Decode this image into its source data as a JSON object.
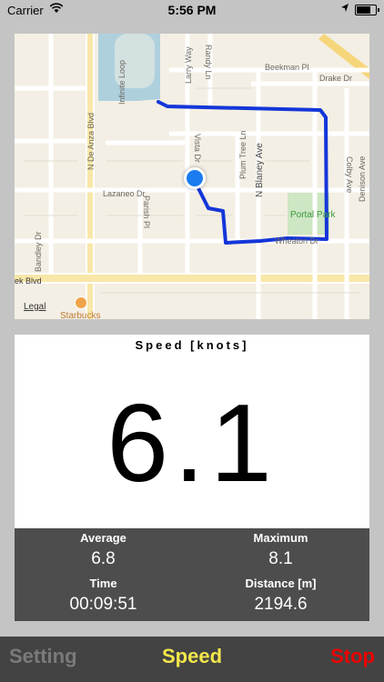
{
  "status_bar": {
    "carrier": "Carrier",
    "time": "5:56 PM",
    "battery_level": 0.85
  },
  "map": {
    "streets": [
      "Beekman Pl",
      "Drake Dr",
      "Larry Way",
      "Randy Ln",
      "Infinite Loop",
      "N De Anza Blvd",
      "Vista Dr",
      "Plum Tree Ln",
      "N Blaney Ave",
      "Colby Ave",
      "Denison Ave",
      "Lazaneo Dr",
      "Parish Pl",
      "Wheaton Dr",
      "Bandley Dr",
      "ek Blvd"
    ],
    "poi": {
      "park": "Portal Park",
      "cafe": "Starbucks"
    },
    "legal": "Legal",
    "route_color": "#1436d9"
  },
  "speed": {
    "label": "Speed [knots]",
    "value": "6.1"
  },
  "stats": {
    "average_label": "Average",
    "average_value": "6.8",
    "maximum_label": "Maximum",
    "maximum_value": "8.1",
    "time_label": "Time",
    "time_value": "00:09:51",
    "distance_label": "Distance [m]",
    "distance_value": "2194.6"
  },
  "tabs": {
    "setting": "Setting",
    "speed": "Speed",
    "stop": "Stop"
  },
  "colors": {
    "speed_tab": "#f2e64c",
    "stop_tab": "#ee0000",
    "setting_tab": "#7a7a7a"
  }
}
